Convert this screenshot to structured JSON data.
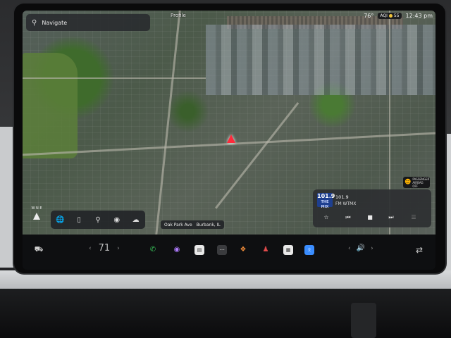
{
  "search": {
    "placeholder": "Navigate",
    "icon": "search-icon"
  },
  "status": {
    "aqi_label": "AQI",
    "aqi_value": "55",
    "time": "12:43 pm",
    "partial_temp": "76°",
    "aqi_color": "#f0c43a"
  },
  "map": {
    "labels": [
      "Profile",
      "Oak Park Ave",
      "Burbank, IL"
    ],
    "marker_color": "#ff2a3b"
  },
  "passenger_airbag": {
    "line1": "PASSENGER",
    "line2": "AIRBAG OFF"
  },
  "compass": {
    "directions": [
      "W",
      "N",
      "E"
    ]
  },
  "map_controls": [
    "globe-icon",
    "phone-icon",
    "pin-icon",
    "target-icon",
    "car-icon"
  ],
  "media": {
    "logo_main": "101.9",
    "logo_sub": "THE MIX",
    "frequency": "101.9",
    "station": "FM WTMX",
    "controls": [
      "star-icon",
      "previous-icon",
      "stop-icon",
      "next-icon",
      "eq-icon"
    ]
  },
  "dock": {
    "temperature": "71",
    "apps": [
      "car-icon",
      "phone-icon",
      "camera-icon",
      "notes-icon",
      "more-icon",
      "apps-icon",
      "joystick-icon",
      "calendar-icon",
      "bluetooth-icon"
    ],
    "volume_icon": "speaker-icon",
    "swap_icon": "swap-icon"
  },
  "colors": {
    "accent_bluetooth": "#3a8dff",
    "phone_green": "#38c45a"
  }
}
